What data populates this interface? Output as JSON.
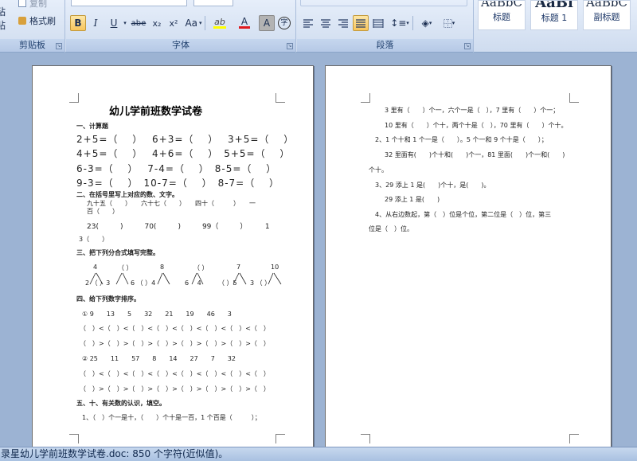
{
  "ribbon": {
    "clipboard": {
      "paste": "粘贴",
      "copy": "复制",
      "format_painter": "格式刷",
      "group_label": "剪贴板"
    },
    "font": {
      "group_label": "字体",
      "bold": "B",
      "italic": "I",
      "underline": "U",
      "strike": "abe",
      "subscript": "x₂",
      "superscript": "x²",
      "change_case": "Aa",
      "highlight": "ab",
      "font_color": "A",
      "char_shading": "A",
      "enclose": "字"
    },
    "paragraph": {
      "group_label": "段落"
    },
    "styles": [
      {
        "sample": "AaBbC",
        "name": "标题"
      },
      {
        "sample": "AaBl",
        "name": "标题 1"
      },
      {
        "sample": "AaBbC",
        "name": "副标题"
      }
    ]
  },
  "page1": {
    "title": "幼儿学前班数学试卷",
    "s1_heading": "一、计算题",
    "calc_rows": [
      "2+5=（　 ）　 6+3=（　 ）　 3+5=（　 ）",
      "4+5=（　 ）　 4+6=（　 ）　5+5=（　 ）",
      "6-3=（　 ）　 7-4=（　 ）　8-5=（　 ）",
      "9-3=（　 ）　10-7=（　 ）　8-7=（　 ）"
    ],
    "s2_heading": "二、在括号里写上对应的数、文字。",
    "s2_line1": "九十五（　　）　　六十七（　　）　　四十（　　　）　　一",
    "s2_line1b": "百（　　）",
    "s2_line2": "23(　　　)　　　70(　　　)　　　99（　　　）　　　1",
    "s2_line3": "3（　　）",
    "s3_heading": "三、把下列分合式填写完整。",
    "s3_tops": [
      "4",
      "（ ）",
      "8",
      "（ ）",
      "7",
      "10"
    ],
    "s3_bottoms": [
      "2 （ ）3",
      "6 （ ）4",
      "6 　4",
      "（ ）5",
      "3 （ ）"
    ],
    "s4_heading": "四、给下列数字排序。",
    "s4_set1": "① 9　　13　　5　　32　　21　　19　　46　　3",
    "s4_lt": "（　）<（　）<（　）<（　）<（　）<（　）<（　）<（　）",
    "s4_gt": "（　）>（　）>（　）>（　）>（　）>（　）>（　）>（　）",
    "s4_set2": "② 25　　11　　57　　8　　14　　27　　7　　32",
    "s5_heading": "五、十、有关数的认识，填空。",
    "s5_line1": "1、（　）个一是十，（　　）个十是一百，1 个百是（　　　）；"
  },
  "page2": {
    "lines": [
      "3 里有（　　）个一，六个一是（　），7 里有（　　）个一；",
      "10 里有（　　）个十，两个十是（　），70 里有（　　）个十。",
      "2、1 个十和 1 个一是（　　）。5 个一和 9 个十是（　　）；",
      "32 里面有(　　)个十和(　　)个一，81 里面(　　)个一和(　　)",
      "个十。",
      "3、29 添上 1 是(　　)个十，是(　　)。",
      "29 添上 1 是(　　)",
      "4、从右边数起，第（　）位是个位，第二位是（　）位，第三",
      "位是（　）位。"
    ]
  },
  "status": {
    "text": "录星幼儿学前班数学试卷.doc: 850 个字符(近似值)。"
  }
}
